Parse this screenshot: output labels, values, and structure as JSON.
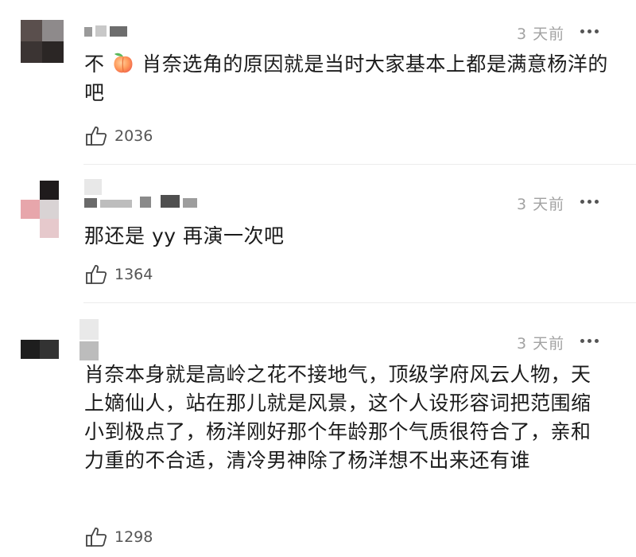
{
  "comments": [
    {
      "text_before_emoji": "不",
      "emoji": "peach-emoji",
      "text_after_emoji": "肖奈选角的原因就是当时大家基本上都是满意杨洋的吧",
      "time": "3 天前",
      "likes": "2036"
    },
    {
      "text": "那还是 yy 再演一次吧",
      "time": "3 天前",
      "likes": "1364"
    },
    {
      "text": "肖奈本身就是高岭之花不接地气，顶级学府风云人物，天上嫡仙人，站在那儿就是风景，这个人设形容词把范围缩小到极点了，杨洋刚好那个年龄那个气质很符合了，亲和力重的不合适，清冷男神除了杨洋想不出来还有谁",
      "time": "3 天前",
      "likes": "1298"
    }
  ],
  "icons": {
    "like": "thumbs-up-outline-icon",
    "more": "more-dots-icon"
  },
  "colors": {
    "text": "#1b1b1b",
    "meta": "#a2a2a2",
    "divider": "#ececec"
  }
}
